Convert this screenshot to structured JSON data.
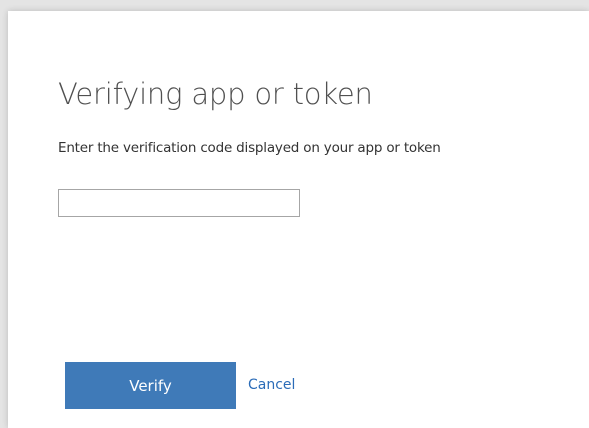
{
  "dialog": {
    "title": "Verifying app or token",
    "description": "Enter the verification code displayed on your app or token",
    "code_input": {
      "value": "",
      "placeholder": ""
    },
    "verify_label": "Verify",
    "cancel_label": "Cancel"
  },
  "colors": {
    "primary_button": "#3f7ab8",
    "link": "#2b6cb8",
    "title_text": "#505050",
    "background": "#e4e4e4"
  }
}
